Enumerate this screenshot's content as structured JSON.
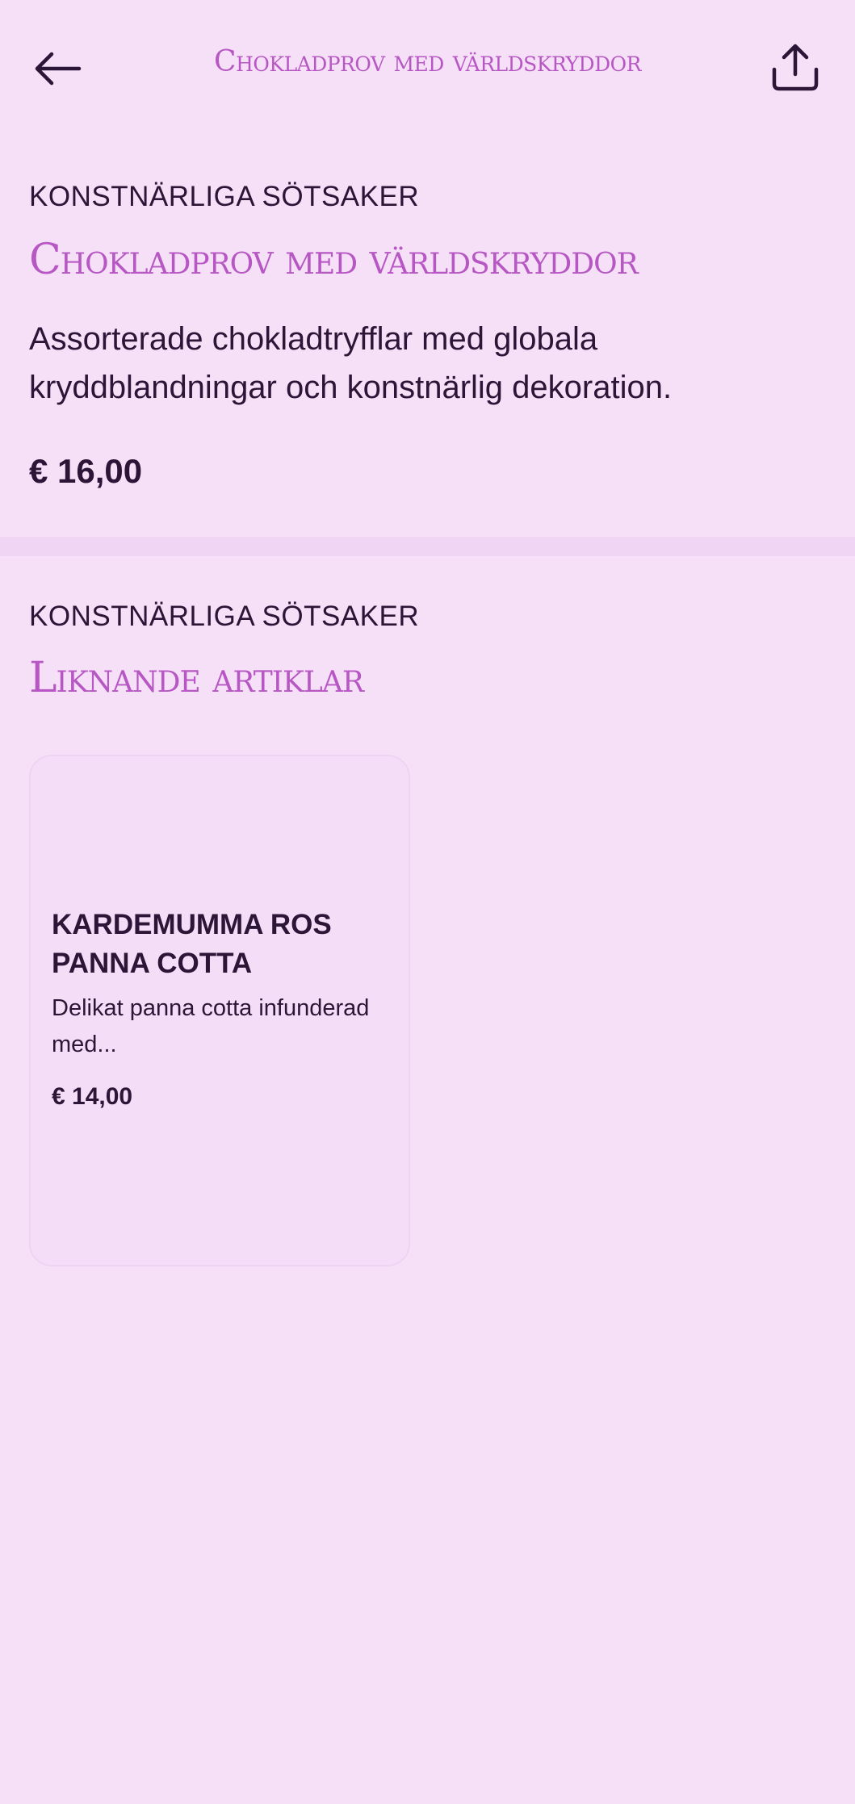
{
  "header": {
    "title": "Chokladprov med världskryddor",
    "back_icon": "arrow-left-icon",
    "share_icon": "share-icon"
  },
  "product": {
    "category": "KONSTNÄRLIGA SÖTSAKER",
    "title": "Chokladprov med världskryddor",
    "description": "Assorterade chokladtryfflar med globala kryddblandningar och konstnärlig dekoration.",
    "price": "€ 16,00"
  },
  "similar": {
    "category": "KONSTNÄRLIGA SÖTSAKER",
    "title": "Liknande artiklar",
    "items": [
      {
        "name": "KARDEMUMMA ROS PANNA COTTA",
        "description": "Delikat panna cotta infunderad med...",
        "price": "€ 14,00"
      }
    ]
  },
  "colors": {
    "background": "#f5e0f8",
    "accent": "#b757c3",
    "text": "#2c1638",
    "divider": "#f1d5f4"
  }
}
